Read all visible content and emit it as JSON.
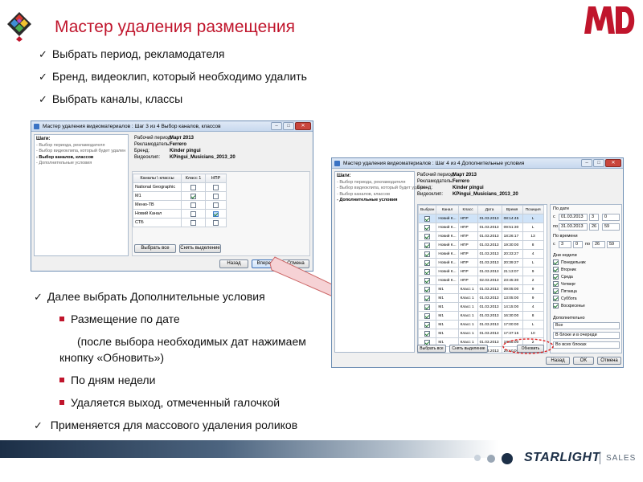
{
  "slide": {
    "title": "Мастер удаления размещения",
    "bullets_top": [
      "Выбрать период, рекламодателя",
      "Бренд, видеоклип,  который необходимо удалить",
      "Выбрать каналы, классы"
    ],
    "bullets_bottom": {
      "b1": "Далее выбрать Дополнительные условия",
      "b2": "Размещение по дате",
      "b3a": "(после выбора необходимых дат нажимаем",
      "b3b": "кнопку «Обновить»)",
      "b4": "По дням недели",
      "b5": "Удаляется выход, отмеченный галочкой",
      "b6": "Применяется для массового удаления роликов"
    },
    "logo_text": "MD",
    "brand": "STARLIGHT",
    "brand_sub": "SALES",
    "colors": {
      "accent": "#c0152c",
      "window_border": "#6f8fb4",
      "footer_dark": "#1c2f47"
    }
  },
  "win1": {
    "title": "Мастер удаления видеоматериалов : Шаг 3 из 4 Выбор каналов, классов",
    "steps_header": "Шаги:",
    "steps": [
      "- Выбор периода, рекламодателя",
      "- Выбор видеоклипа, который будет удален",
      "- Выбор каналов, классов",
      "- Дополнительные условия"
    ],
    "info": [
      {
        "label": "Рабочий период:",
        "value": "Март 2013"
      },
      {
        "label": "Рекламодатель:",
        "value": "Ferrero"
      },
      {
        "label": "Бренд:",
        "value": "Kinder pingui"
      },
      {
        "label": "Видеоклип:",
        "value": "KPingui_Musicians_2013_20"
      }
    ],
    "grid_headers": [
      "Каналы \\ классы",
      "Класс 1",
      "НПР"
    ],
    "grid_rows": [
      {
        "name": "National Geographic",
        "c1": false,
        "c2": false
      },
      {
        "name": "M1",
        "c1": true,
        "c2": false
      },
      {
        "name": "Меню-ТВ",
        "c1": false,
        "c2": false
      },
      {
        "name": "Новий Канал",
        "c1": false,
        "c2": true
      },
      {
        "name": "СТБ",
        "c1": false,
        "c2": false
      }
    ],
    "select_all": "Выбрать все",
    "deselect": "Снять выделение",
    "back": "Назад",
    "next": "Вперед",
    "cancel": "Отмена"
  },
  "win2": {
    "title": "Мастер удаления видеоматериалов : Шаг 4 из 4 Дополнительные условия",
    "steps_header": "Шаги:",
    "steps": [
      "- Выбор периода, рекламодателя",
      "- Выбор видеоклипа, который будет удален",
      "- Выбор каналов, классов",
      "- Дополнительные условия"
    ],
    "info": [
      {
        "label": "Рабочий период:",
        "value": "Март 2013"
      },
      {
        "label": "Рекламодатель:",
        "value": "Ferrero"
      },
      {
        "label": "Бренд:",
        "value": "Kinder pingui"
      },
      {
        "label": "Видеоклип:",
        "value": "KPingui_Musicians_2013_20"
      }
    ],
    "table_headers": [
      "Выбран",
      "Канал",
      "Класс",
      "Дата",
      "Время",
      "Позиция"
    ],
    "rows": [
      [
        "Новий К...",
        "НПР",
        "01.03.2013",
        "08:14:45",
        "L"
      ],
      [
        "Новий К...",
        "НПР",
        "01.03.2013",
        "09:51:30",
        "L"
      ],
      [
        "Новий К...",
        "НПР",
        "01.03.2013",
        "18:26:17",
        "13"
      ],
      [
        "Новий К...",
        "НПР",
        "01.03.2013",
        "19:30:00",
        "8"
      ],
      [
        "Новий К...",
        "НПР",
        "01.03.2013",
        "20:33:27",
        "4"
      ],
      [
        "Новий К...",
        "НПР",
        "01.03.2013",
        "20:39:27",
        "L"
      ],
      [
        "Новий К...",
        "НПР",
        "01.03.2013",
        "21:13:07",
        "9"
      ],
      [
        "Новий К...",
        "НПР",
        "02.03.2013",
        "23:45:30",
        "2"
      ],
      [
        "M1",
        "Класс 1",
        "01.03.2013",
        "09:05:00",
        "9"
      ],
      [
        "M1",
        "Класс 1",
        "01.03.2013",
        "13:05:00",
        "9"
      ],
      [
        "M1",
        "Класс 1",
        "01.03.2013",
        "14:15:00",
        "4"
      ],
      [
        "M1",
        "Класс 1",
        "01.03.2013",
        "16:30:00",
        "8"
      ],
      [
        "M1",
        "Класс 1",
        "01.03.2013",
        "17:00:00",
        "L"
      ],
      [
        "M1",
        "Класс 1",
        "01.03.2013",
        "17:37:15",
        "10"
      ],
      [
        "M1",
        "Класс 1",
        "01.03.2013",
        "18:35:00",
        "2"
      ],
      [
        "M1",
        "Класс 1",
        "01.03.2013",
        "20:10:00",
        "15"
      ],
      [
        "M1",
        "Класс 1",
        "01.03.2013",
        "21:10:00",
        "?"
      ]
    ],
    "select_all": "Выбрать все",
    "deselect": "Снять выделение",
    "refresh": "Обновить",
    "by_date_label": "По дате",
    "from_label": "с",
    "to_label": "по",
    "date_from": "01.03.2013",
    "date_to": "31.03.2013",
    "hour_from": "3",
    "min_from": "0",
    "hour_to": "26",
    "min_to": "59",
    "by_time_label": "По времени",
    "time_from": "3",
    "time_from_min": "0",
    "time_to": "26",
    "time_to_min": "59",
    "weekdays_label": "Дни недели",
    "weekdays": [
      "Понедельник",
      "Вторник",
      "Среда",
      "Четверг",
      "Пятница",
      "Суббота",
      "Воскресенье"
    ],
    "extra_label": "Дополнительно",
    "extra_selects": [
      "Все",
      "В блоке и в очереди",
      "Во всех блоках"
    ],
    "back": "Назад",
    "ok": "OK",
    "cancel": "Отмена"
  }
}
